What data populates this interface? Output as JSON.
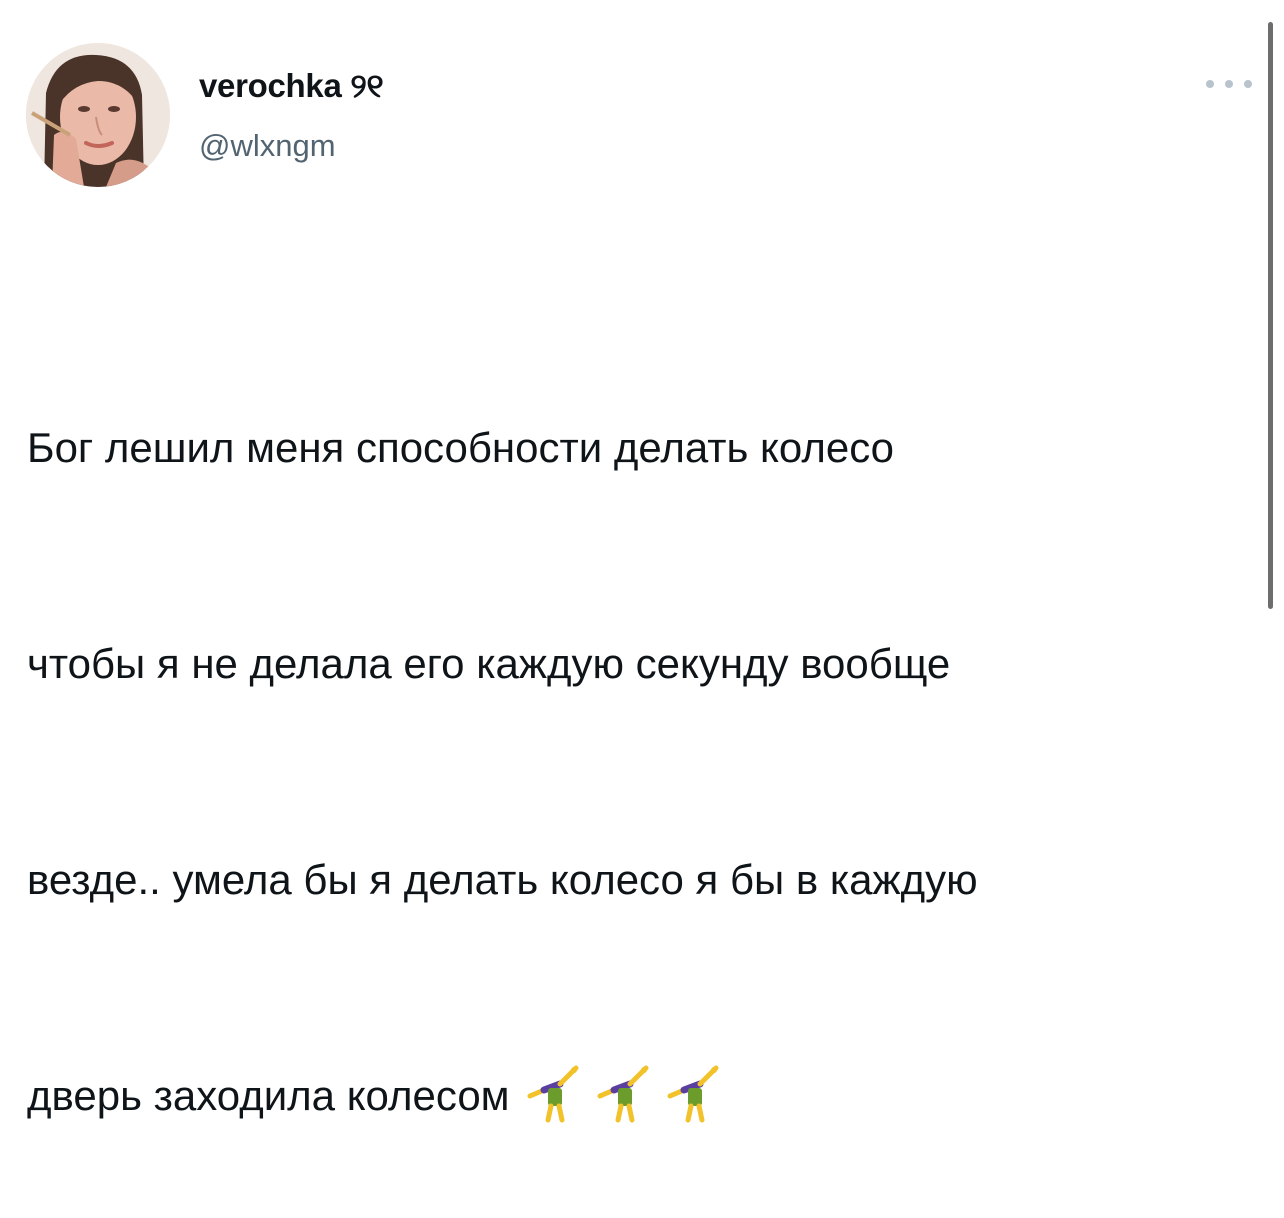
{
  "tweet": {
    "display_name": "verochka ୨୧",
    "handle": "@wlxngm",
    "text_lines": [
      "Бог лешил меня способности делать колесо",
      "чтобы я не делала его каждую секунду вообще",
      "везде.. умела бы я делать колесо я бы в каждую",
      "дверь заходила колесом"
    ],
    "emoji": [
      "cartwheel-icon",
      "cartwheel-icon",
      "cartwheel-icon"
    ]
  },
  "colors": {
    "text_primary": "#0f1419",
    "text_secondary": "#536471",
    "more_dots": "#b9c3cc",
    "background": "#ffffff"
  }
}
